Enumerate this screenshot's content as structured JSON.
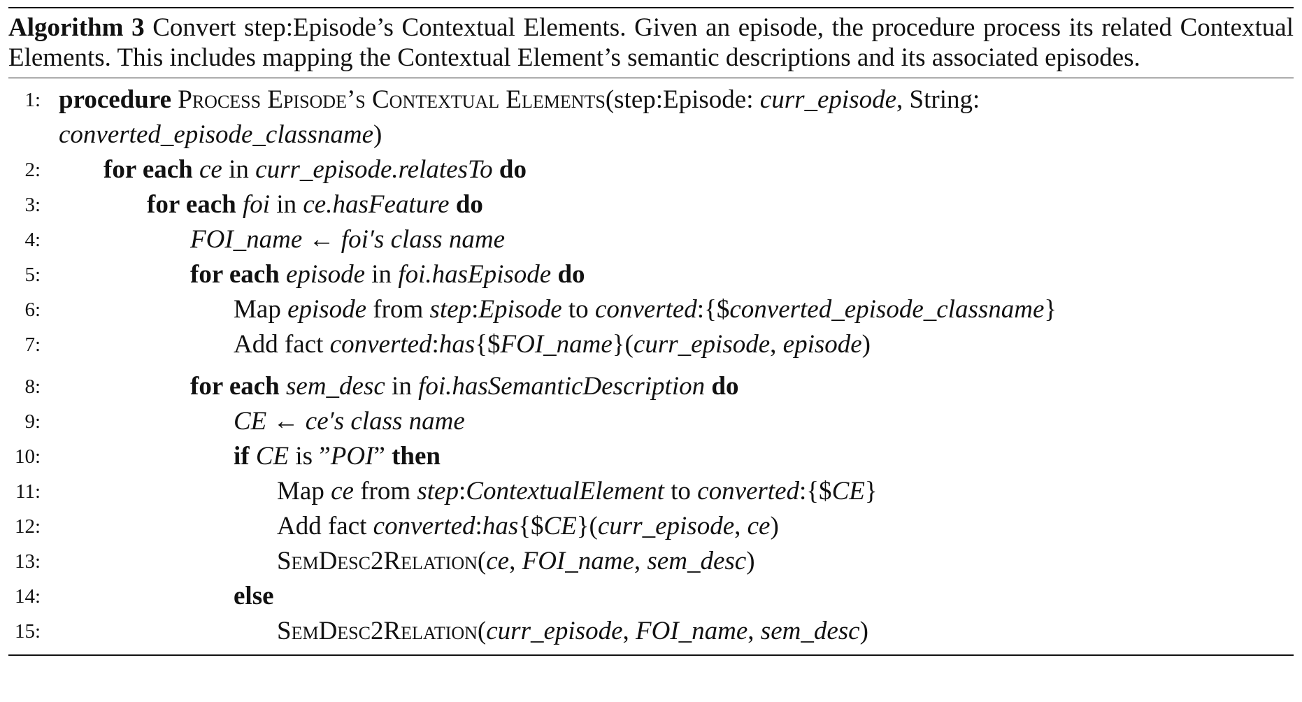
{
  "caption": {
    "label": "Algorithm 3",
    "text": "Convert step:Episode’s Contextual Elements. Given an episode, the procedure process its related Contextual Elements. This includes mapping the Contextual Element’s semantic descriptions and its associated episodes."
  },
  "lines": [
    {
      "n": "1:",
      "kw1": "procedure",
      "name": "Process Episode’s Contextual Elements",
      "args": "(step:Episode: ",
      "arg1": "curr_episode",
      "sep": ", String:",
      "arg2": "converted_episode_classname",
      "close": ")"
    },
    {
      "n": "2:",
      "kw1": "for each",
      "a": "ce",
      "in": " in ",
      "b": "curr_episode.relatesTo",
      "kw2": "do"
    },
    {
      "n": "3:",
      "kw1": "for each",
      "a": "foi",
      "in": " in ",
      "b": "ce.hasFeature",
      "kw2": "do"
    },
    {
      "n": "4:",
      "a": "FOI_name",
      "arrow": " ← ",
      "b": "foi′s class name"
    },
    {
      "n": "5:",
      "kw1": "for each",
      "a": "episode",
      "in": " in ",
      "b": "foi.hasEpisode",
      "kw2": "do"
    },
    {
      "n": "6:",
      "t1": "Map ",
      "a": "episode",
      "t2": " from ",
      "b": "step",
      "t3": ":",
      "c": "Episode",
      "t4": " to ",
      "d": "converted",
      "t5": ":{$",
      "e": "converted_episode_classname",
      "t6": "}"
    },
    {
      "n": "7:",
      "t1": "Add fact ",
      "a": "converted",
      "t2": ":",
      "b": "has",
      "t3": "{$",
      "c": "FOI_name",
      "t4": "}(",
      "d": "curr_episode",
      "t5": ", ",
      "e": "episode",
      "t6": ")"
    },
    {
      "n": "8:",
      "kw1": "for each",
      "a": "sem_desc",
      "in": " in ",
      "b": "foi.hasSemanticDescription",
      "kw2": "do"
    },
    {
      "n": "9:",
      "a": "CE",
      "arrow": " ← ",
      "b": "ce′s class name"
    },
    {
      "n": "10:",
      "kw1": "if",
      "a": "CE",
      "t1": " is ”",
      "b": "POI",
      "t2": "” ",
      "kw2": "then"
    },
    {
      "n": "11:",
      "t1": "Map ",
      "a": "ce",
      "t2": " from ",
      "b": "step",
      "t3": ":",
      "c": "ContextualElement",
      "t4": " to ",
      "d": "converted",
      "t5": ":{$",
      "e": "CE",
      "t6": "}"
    },
    {
      "n": "12:",
      "t1": "Add fact ",
      "a": "converted",
      "t2": ":",
      "b": "has",
      "t3": "{$",
      "c": "CE",
      "t4": "}(",
      "d": "curr_episode",
      "t5": ", ",
      "e": "ce",
      "t6": ")"
    },
    {
      "n": "13:",
      "name": "SemDesc2Relation",
      "t1": "(",
      "a": "ce",
      "t2": ", ",
      "b": "FOI_name",
      "t3": ", ",
      "c": "sem_desc",
      "t4": ")"
    },
    {
      "n": "14:",
      "kw1": "else"
    },
    {
      "n": "15:",
      "name": "SemDesc2Relation",
      "t1": "(",
      "a": "curr_episode",
      "t2": ", ",
      "b": "FOI_name",
      "t3": ", ",
      "c": "sem_desc",
      "t4": ")"
    }
  ]
}
